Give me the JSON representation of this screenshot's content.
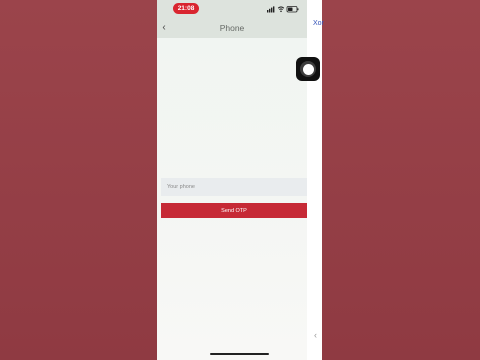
{
  "status_bar": {
    "time": "21:08",
    "icons": [
      "signal-icon",
      "wifi-icon",
      "battery-icon"
    ]
  },
  "nav": {
    "back_icon": "chevron-left-icon",
    "back_glyph": "‹",
    "title": "Phone"
  },
  "form": {
    "phone_placeholder": "Your phone",
    "phone_value": "",
    "send_label": "Send OTP"
  },
  "side_panel": {
    "label": "Xor",
    "chevron_glyph": "‹"
  },
  "colors": {
    "background": "#9a3f46",
    "time_pill": "#d9252f",
    "primary_button": "#c62a36",
    "link": "#3554b8"
  }
}
